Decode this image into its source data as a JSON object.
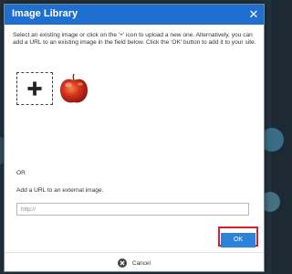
{
  "dialog": {
    "title": "Image Library",
    "close_icon": "close-icon",
    "instructions": "Select an existing image or click on the '+' icon to upload a new one. Alternatively, you can add a URL to an existing image in the field below. Click the 'OK' button to add it to your site.",
    "upload_icon": "plus-icon",
    "or_label": "OR",
    "url_label": "Add a URL to an external image.",
    "url_input": {
      "value": "",
      "placeholder": "http://"
    },
    "ok_label": "OK",
    "cancel_label": "Cancel",
    "cancel_icon": "cancel-circle-icon"
  },
  "colors": {
    "header": "#1f6fd0",
    "ok_button": "#2b84d9",
    "highlight": "#d3202a"
  }
}
